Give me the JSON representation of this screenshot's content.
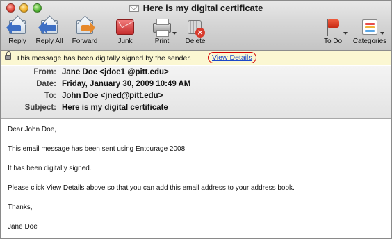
{
  "window": {
    "title": "Here is my digital certificate"
  },
  "toolbar": {
    "reply": "Reply",
    "reply_all": "Reply All",
    "forward": "Forward",
    "junk": "Junk",
    "print": "Print",
    "delete": "Delete",
    "todo": "To Do",
    "categories": "Categories"
  },
  "security": {
    "message": "This message has been digitally signed  by the sender.",
    "link": "View Details"
  },
  "header": {
    "from_label": "From:",
    "from": "Jane Doe <jdoe1 @pitt.edu>",
    "date_label": "Date:",
    "date": "Friday, January 30, 2009 10:49 AM",
    "to_label": "To:",
    "to": "John Doe  <jned@pitt.edu>",
    "subject_label": "Subject:",
    "subject": "Here is my digital certificate"
  },
  "body": {
    "greeting": "Dear John Doe,",
    "p1": "This email message has been sent using Entourage 2008.",
    "p2": "It has been digitally signed.",
    "p3": "Please click View Details above so that you can add this email address to your address book.",
    "closing": "Thanks,",
    "signature": "Jane Doe"
  },
  "colors": {
    "link": "#1c47c9",
    "highlight_circle": "#d40000",
    "security_bar": "#fbf7d2"
  }
}
